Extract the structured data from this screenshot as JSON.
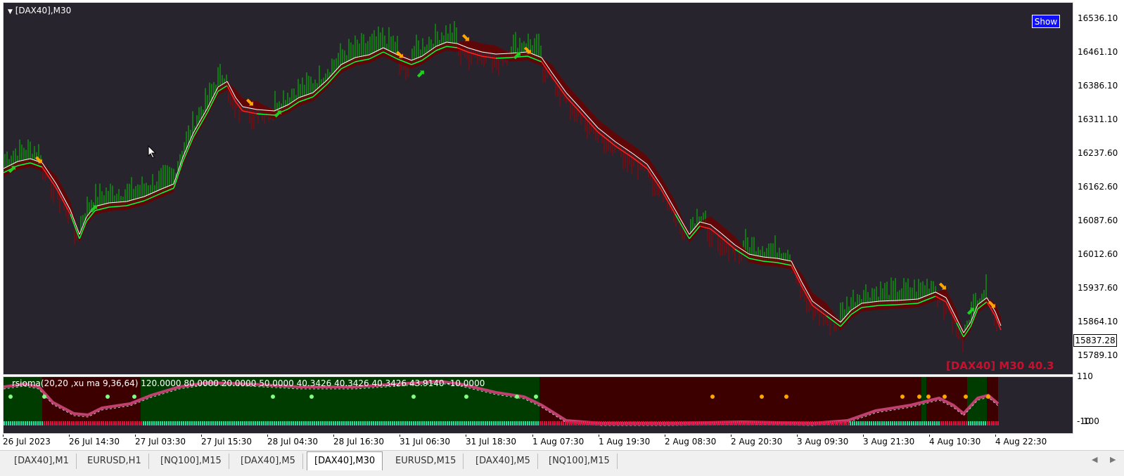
{
  "chart": {
    "title": "[DAX40],M30",
    "show_button": "Show",
    "watermark": "[DAX40] M30  40.3",
    "current_price": "15837.28",
    "price_labels": [
      "16536.10",
      "16461.10",
      "16386.10",
      "16311.10",
      "16237.60",
      "16162.60",
      "16087.60",
      "16012.60",
      "15937.60",
      "15864.10",
      "15789.10"
    ],
    "time_labels": [
      "26 Jul 2023",
      "26 Jul 14:30",
      "27 Jul 03:30",
      "27 Jul 15:30",
      "28 Jul 04:30",
      "28 Jul 16:30",
      "31 Jul 06:30",
      "31 Jul 18:30",
      "1 Aug 07:30",
      "1 Aug 19:30",
      "2 Aug 08:30",
      "2 Aug 20:30",
      "3 Aug 09:30",
      "3 Aug 21:30",
      "4 Aug 10:30",
      "4 Aug 22:30"
    ],
    "colors": {
      "background": "#28242e",
      "bull": "#00e000",
      "bear": "#c00000",
      "arrow": "#ffa500"
    }
  },
  "indicator": {
    "label": "rsioma(20,20 ,xu ma 9,36,64) 120.0000 80.0000 20.0000 50.0000 40.3426 40.3426 40.3426 43.9140 -10.0000",
    "axis_top": "110",
    "axis_bottom": "-10",
    "axis_bottom2": "100"
  },
  "tabs": [
    {
      "label": "[DAX40],M1"
    },
    {
      "label": "EURUSD,H1"
    },
    {
      "label": "[NQ100],M15"
    },
    {
      "label": "[DAX40],M5"
    },
    {
      "label": "[DAX40],M30",
      "active": true
    },
    {
      "label": "EURUSD,M15"
    },
    {
      "label": "[DAX40],M5"
    },
    {
      "label": "[NQ100],M15"
    }
  ]
}
